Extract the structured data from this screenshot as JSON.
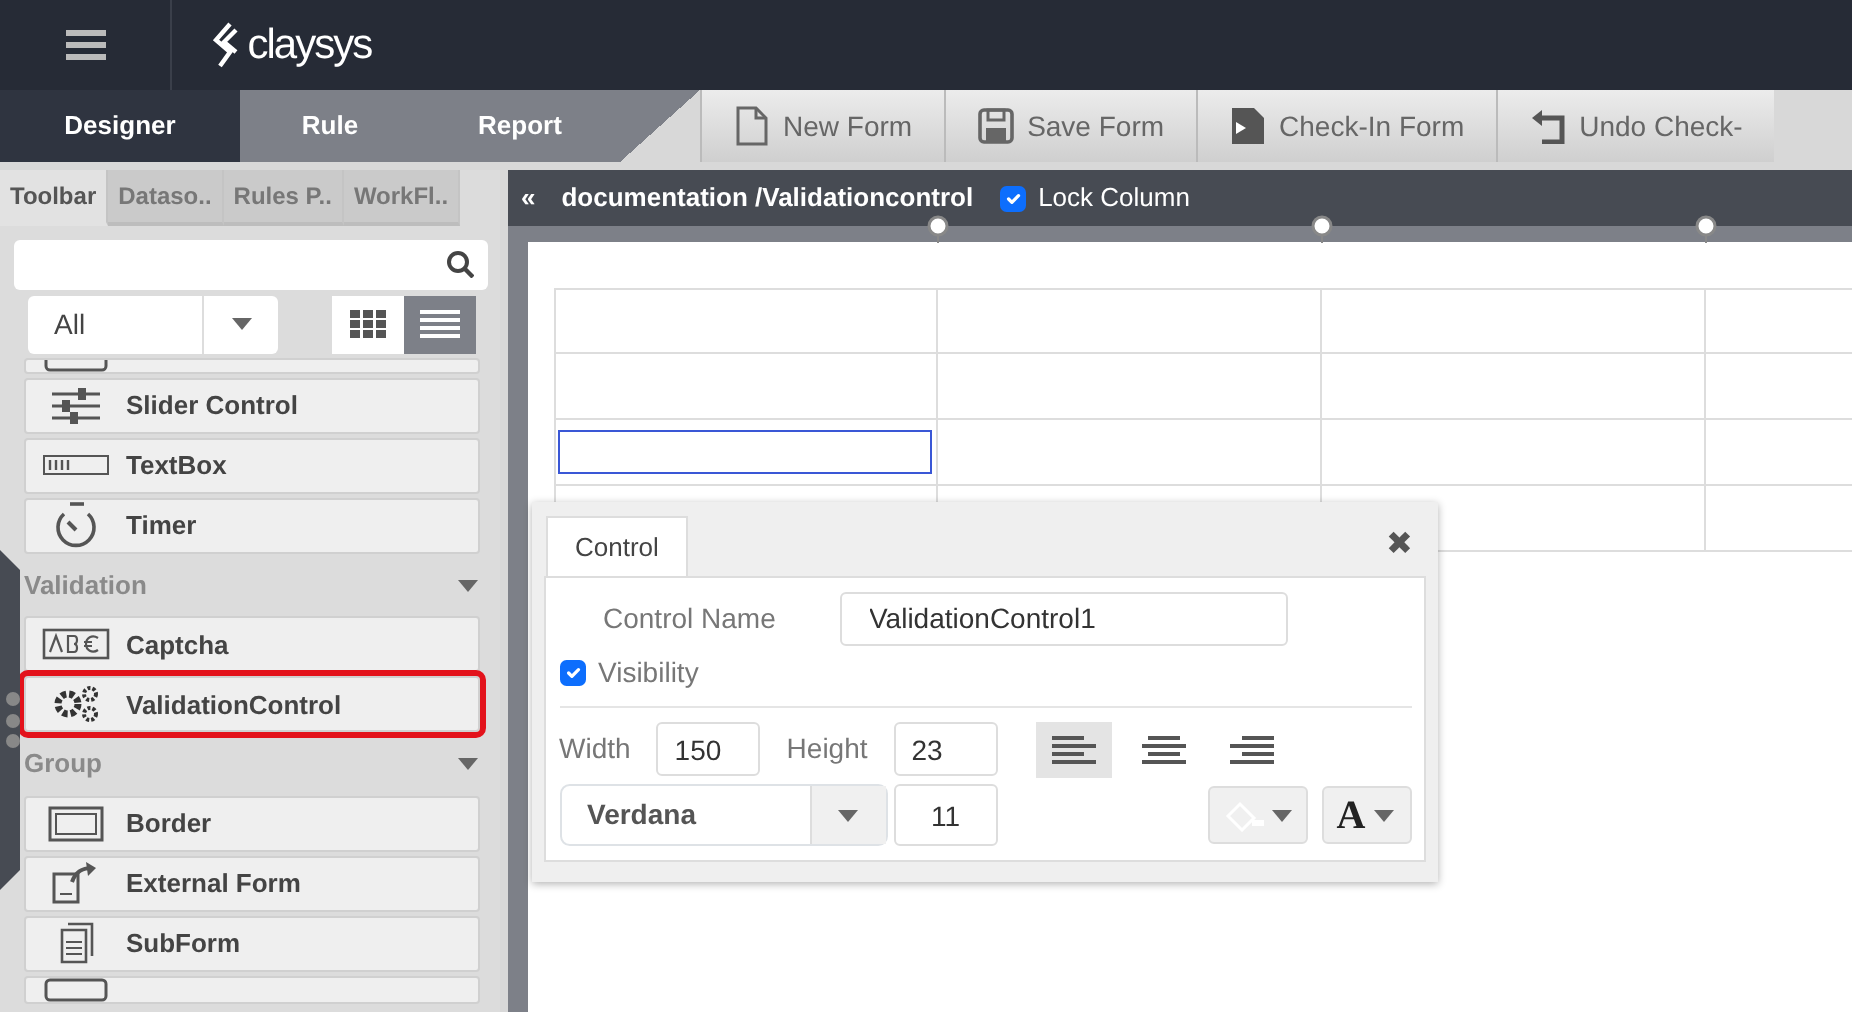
{
  "header": {
    "logo": "claysys"
  },
  "main_tabs": [
    {
      "label": "Designer",
      "selected": true
    },
    {
      "label": "Rule",
      "selected": false
    },
    {
      "label": "Report",
      "selected": false
    }
  ],
  "toolbar_buttons": [
    {
      "label": "New Form"
    },
    {
      "label": "Save Form"
    },
    {
      "label": "Check-In Form"
    },
    {
      "label": "Undo Check-"
    }
  ],
  "panel_tabs": [
    {
      "label": "Toolbar",
      "selected": true
    },
    {
      "label": "Dataso..",
      "selected": false
    },
    {
      "label": "Rules P..",
      "selected": false
    },
    {
      "label": "WorkFl..",
      "selected": false
    }
  ],
  "filter": {
    "value": "All"
  },
  "view_toggle": [
    {
      "kind": "grid",
      "selected": false
    },
    {
      "kind": "list",
      "selected": true
    }
  ],
  "toolbox": [
    {
      "kind": "partial"
    },
    {
      "kind": "item",
      "label": "Slider Control",
      "highlighted": false
    },
    {
      "kind": "item",
      "label": "TextBox",
      "highlighted": false
    },
    {
      "kind": "item",
      "label": "Timer",
      "highlighted": false
    },
    {
      "kind": "header",
      "label": "Validation"
    },
    {
      "kind": "item",
      "label": "Captcha",
      "highlighted": false
    },
    {
      "kind": "item",
      "label": "ValidationControl",
      "highlighted": true
    },
    {
      "kind": "header",
      "label": "Group"
    },
    {
      "kind": "item",
      "label": "Border",
      "highlighted": false
    },
    {
      "kind": "item",
      "label": "External Form",
      "highlighted": false
    },
    {
      "kind": "item",
      "label": "SubForm",
      "highlighted": false
    },
    {
      "kind": "partial"
    }
  ],
  "breadcrumb": {
    "collapse": "«",
    "path": "documentation /Validationcontrol",
    "lock_column": {
      "label": "Lock Column",
      "checked": true
    }
  },
  "properties": {
    "tabs": [
      {
        "label": "Control",
        "selected": true
      }
    ],
    "close": "✖",
    "control_name": {
      "label": "Control Name",
      "value": "ValidationControl1"
    },
    "visibility": {
      "label": "Visibility",
      "checked": true
    },
    "width": {
      "label": "Width",
      "value": "150"
    },
    "height": {
      "label": "Height",
      "value": "23"
    },
    "alignment": [
      {
        "kind": "left",
        "selected": true
      },
      {
        "kind": "center",
        "selected": false
      },
      {
        "kind": "right",
        "selected": false
      }
    ],
    "font": {
      "value": "Verdana"
    },
    "font_size": {
      "value": "11"
    },
    "text_color": {
      "glyph": "A"
    }
  }
}
